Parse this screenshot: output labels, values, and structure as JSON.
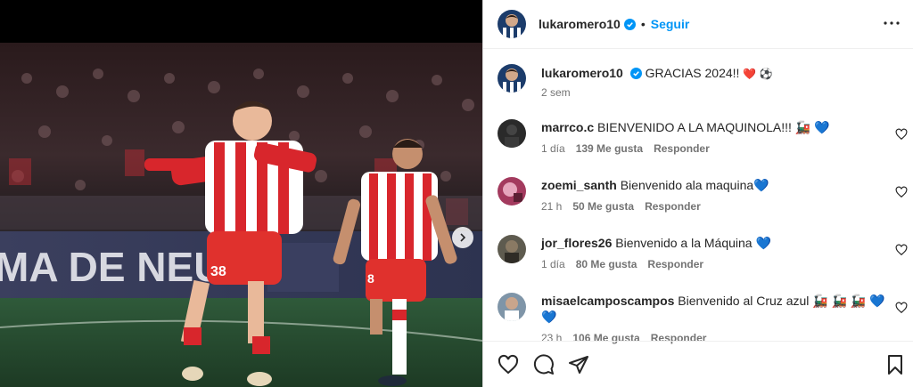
{
  "post": {
    "author": "lukaromero10",
    "follow_label": "Seguir",
    "dot": "•",
    "caption": {
      "user": "lukaromero10",
      "text": "GRACIAS 2024!!",
      "emojis": "❤️ ⚽",
      "time": "2 sem"
    }
  },
  "comments": [
    {
      "user": "marrco.c",
      "text": "BIENVENIDO A LA MAQUINOLA!!! 🚂 💙",
      "time": "1 día",
      "likes": "139 Me gusta",
      "reply": "Responder"
    },
    {
      "user": "zoemi_santh",
      "text": "Bienvenido ala maquina💙",
      "time": "21 h",
      "likes": "50 Me gusta",
      "reply": "Responder"
    },
    {
      "user": "jor_flores26",
      "text": "Bienvenido a la Máquina 💙",
      "time": "1 día",
      "likes": "80 Me gusta",
      "reply": "Responder"
    },
    {
      "user": "misaelcamposcampos",
      "text": "Bienvenido al Cruz azul 🚂 🚂 🚂 💙 💙",
      "time": "23 h",
      "likes": "106 Me gusta",
      "reply": "Responder"
    }
  ],
  "colors": {
    "accent": "#0095f6",
    "verified": "#0095f6",
    "kit_red": "#d8262c"
  },
  "icons": [
    "chevron-right-icon",
    "more-icon",
    "verified-icon",
    "heart-icon",
    "comment-icon",
    "share-icon",
    "bookmark-icon"
  ]
}
